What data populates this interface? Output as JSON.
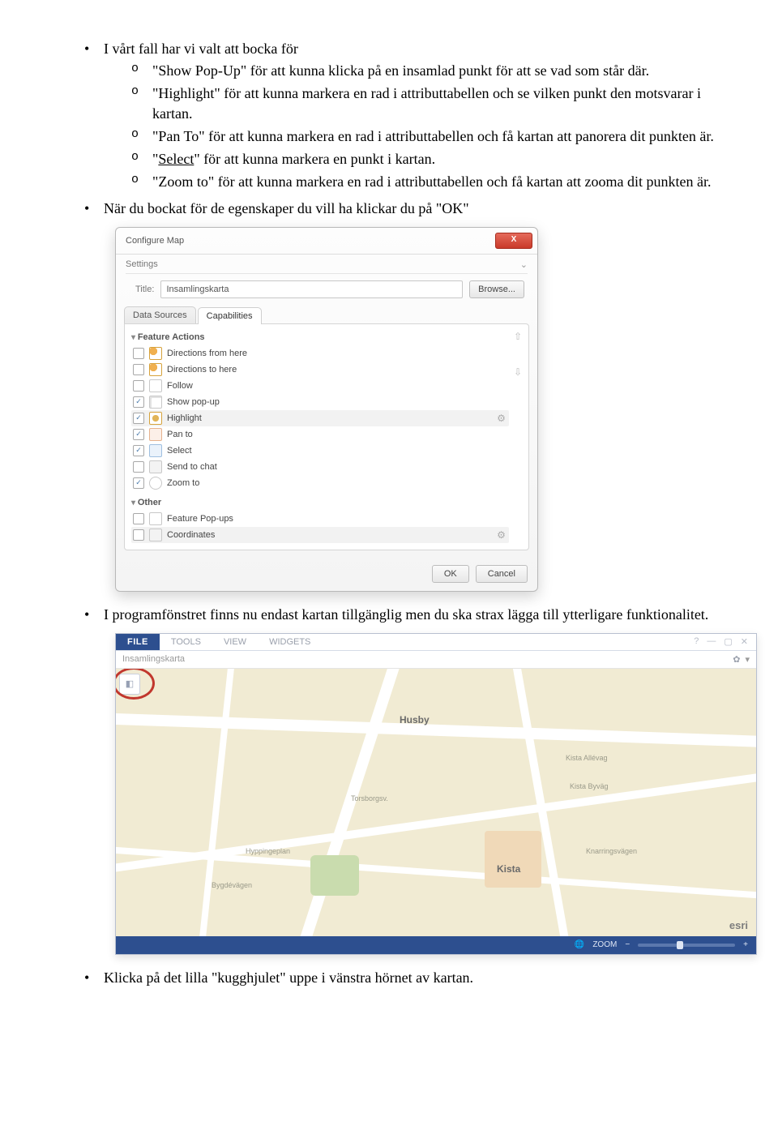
{
  "para1": "I vårt fall har vi valt att bocka för",
  "li1a": "\"Show Pop-Up\" för att kunna klicka på en insamlad punkt för att se vad som står där.",
  "li1b": "\"Highlight\" för att kunna markera en rad i attributtabellen och se vilken punkt den motsvarar i kartan.",
  "li1c": "\"Pan To\" för att kunna markera en rad i attributtabellen och få kartan att panorera dit punkten är.",
  "li1d_pre": "\"",
  "li1d_u": "Select",
  "li1d_post": "\" för att kunna markera en punkt i kartan.",
  "li1e": "\"Zoom to\" för att kunna markera en rad i attributtabellen och få kartan att zooma dit punkten är.",
  "para2": "När du bockat för de egenskaper du vill ha klickar du på \"OK\"",
  "para3": "I programfönstret finns nu endast kartan tillgänglig men du ska strax lägga till ytterligare funktionalitet.",
  "para4": "Klicka på det lilla \"kugghjulet\" uppe i vänstra hörnet av kartan.",
  "dialog": {
    "title": "Configure Map",
    "settings": "Settings",
    "titleLabel": "Title:",
    "titleValue": "Insamlingskarta",
    "browse": "Browse...",
    "tabs": {
      "data": "Data Sources",
      "cap": "Capabilities"
    },
    "groups": {
      "fa": "Feature Actions",
      "other": "Other"
    },
    "actions": {
      "dirFrom": "Directions from here",
      "dirTo": "Directions to here",
      "follow": "Follow",
      "popup": "Show pop-up",
      "highlight": "Highlight",
      "panto": "Pan to",
      "select": "Select",
      "chat": "Send to chat",
      "zoom": "Zoom to"
    },
    "other": {
      "fpop": "Feature Pop-ups",
      "coord": "Coordinates"
    },
    "ok": "OK",
    "cancel": "Cancel"
  },
  "app": {
    "file": "FILE",
    "tools": "TOOLS",
    "view": "VIEW",
    "widgets": "WIDGETS",
    "docTitle": "Insamlingskarta",
    "husby": "Husby",
    "kista": "Kista",
    "kistaallevag": "Kista Allévag",
    "kistabyvag": "Kista Byväg",
    "torsborg": "Torsborgsv.",
    "hyppinge": "Hyppingeplan",
    "bygdevagen": "Bygdévägen",
    "knarrinsv": "Knarringsvägen",
    "esri": "esri",
    "zoom": "ZOOM"
  }
}
